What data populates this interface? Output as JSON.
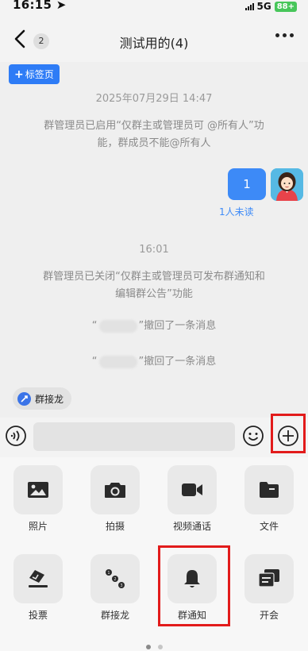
{
  "status_bar": {
    "time": "16:15",
    "network": "5G",
    "battery": "88+"
  },
  "nav": {
    "unread_count": "2",
    "title": "测试用的(4)"
  },
  "tag_button": {
    "label": "标签页"
  },
  "chat": {
    "timestamp_1": "2025年07月29日 14:47",
    "system_1_line1": "群管理员已启用“仅群主或管理员可 @所有人”功",
    "system_1_line2": "能，群成员不能@所有人",
    "message_text": "1",
    "read_status": "1人未读",
    "timestamp_2": "16:01",
    "system_2_line1": "群管理员已关闭“仅群主或管理员可发布群通知和",
    "system_2_line2": "编辑群公告”功能",
    "recall_1_prefix": "“",
    "recall_1_suffix": "”撤回了一条消息",
    "recall_2_prefix": "“",
    "recall_2_suffix": "”撤回了一条消息"
  },
  "quick_bar": {
    "chip_label": "群接龙"
  },
  "input": {
    "placeholder": ""
  },
  "panel": {
    "items": [
      {
        "label": "照片",
        "icon": "photo-icon"
      },
      {
        "label": "拍摄",
        "icon": "camera-icon"
      },
      {
        "label": "视频通话",
        "icon": "video-call-icon"
      },
      {
        "label": "文件",
        "icon": "folder-icon"
      },
      {
        "label": "投票",
        "icon": "vote-icon"
      },
      {
        "label": "群接龙",
        "icon": "relay-icon"
      },
      {
        "label": "群通知",
        "icon": "bell-icon"
      },
      {
        "label": "开会",
        "icon": "meeting-icon"
      }
    ],
    "page_count": 2,
    "active_page": 1
  },
  "colors": {
    "accent": "#3d8af7",
    "highlight": "#e21b1b",
    "battery": "#47c65a"
  }
}
